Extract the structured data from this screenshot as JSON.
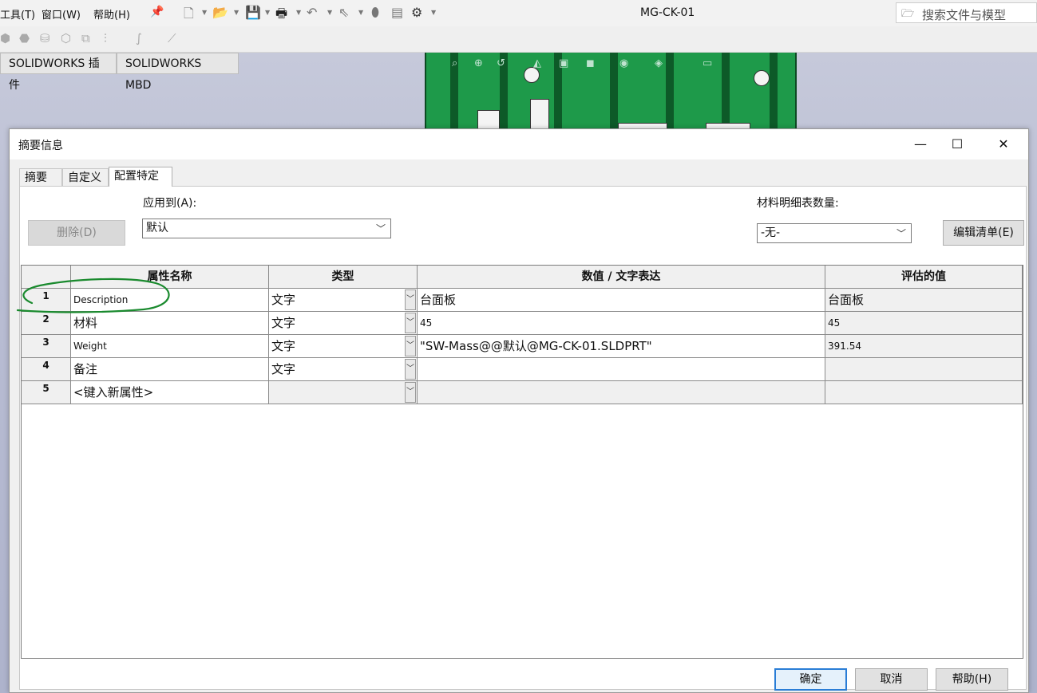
{
  "menu": {
    "tools": "工具(T)",
    "window": "窗口(W)",
    "help": "帮助(H)"
  },
  "toolbar": {
    "pin_icon": "pin-icon"
  },
  "document_title": "MG-CK-01",
  "search": {
    "placeholder": "搜索文件与模型"
  },
  "command_tabs": [
    "SOLIDWORKS 插件",
    "SOLIDWORKS MBD"
  ],
  "dialog": {
    "title": "摘要信息",
    "window_controls": {
      "minimize": "—",
      "maximize": "☐",
      "close": "✕"
    },
    "tabs": [
      "摘要",
      "自定义",
      "配置特定"
    ],
    "active_tab": "配置特定",
    "delete_button": "删除(D)",
    "apply_to_label": "应用到(A):",
    "apply_to_value": "默认",
    "bom_qty_label": "材料明细表数量:",
    "bom_qty_value": "-无-",
    "edit_list_button": "编辑清单(E)",
    "grid": {
      "headers": [
        "属性名称",
        "类型",
        "数值 / 文字表达",
        "评估的值"
      ],
      "rows": [
        {
          "num": "1",
          "name": "Description",
          "type": "文字",
          "value": "台面板",
          "evaluated": "台面板"
        },
        {
          "num": "2",
          "name": "材料",
          "type": "文字",
          "value": "45",
          "evaluated": "45"
        },
        {
          "num": "3",
          "name": "Weight",
          "type": "文字",
          "value": "\"SW-Mass@@默认@MG-CK-01.SLDPRT\"",
          "evaluated": "391.54"
        },
        {
          "num": "4",
          "name": "备注",
          "type": "文字",
          "value": "",
          "evaluated": ""
        },
        {
          "num": "5",
          "name": "<键入新属性>",
          "type": "",
          "value": "",
          "evaluated": ""
        }
      ]
    },
    "footer": {
      "ok": "确定",
      "cancel": "取消",
      "help": "帮助(H)"
    }
  },
  "colors": {
    "part_green": "#1e9a4a",
    "annotation_green": "#1a8a2e",
    "accent_blue": "#2a7dd6"
  }
}
